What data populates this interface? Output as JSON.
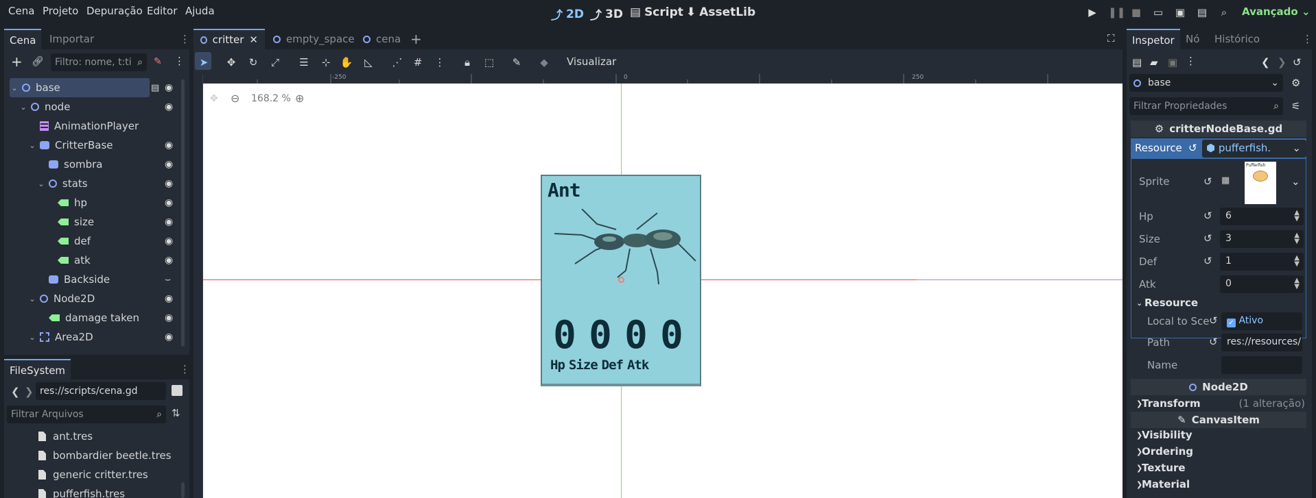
{
  "menu": [
    "Cena",
    "Projeto",
    "Depuração",
    "Editor",
    "Ajuda"
  ],
  "workspaces": {
    "w2d": "2D",
    "w3d": "3D",
    "script": "Script",
    "assetlib": "AssetLib"
  },
  "renderer": "Avançado",
  "scene_dock": {
    "tabs": [
      "Cena",
      "Importar"
    ],
    "filter_placeholder": "Filtro: nome, t:ti",
    "nodes": [
      {
        "label": "base",
        "icon": "node-circle",
        "depth": 0,
        "arrow": "expanded",
        "eye": true,
        "script": true,
        "selected": true
      },
      {
        "label": "node",
        "icon": "node-circle",
        "depth": 1,
        "arrow": "expanded",
        "eye": true
      },
      {
        "label": "AnimationPlayer",
        "icon": "animation-player",
        "depth": 2,
        "arrow": "",
        "eye": false
      },
      {
        "label": "CritterBase",
        "icon": "node-rect",
        "depth": 2,
        "arrow": "expanded",
        "eye": true
      },
      {
        "label": "sombra",
        "icon": "node-rect",
        "depth": 3,
        "arrow": "",
        "eye": true
      },
      {
        "label": "stats",
        "icon": "node-circle",
        "depth": 3,
        "arrow": "expanded",
        "eye": true
      },
      {
        "label": "hp",
        "icon": "node-tag",
        "depth": 4,
        "arrow": "",
        "eye": true
      },
      {
        "label": "size",
        "icon": "node-tag",
        "depth": 4,
        "arrow": "",
        "eye": true
      },
      {
        "label": "def",
        "icon": "node-tag",
        "depth": 4,
        "arrow": "",
        "eye": true
      },
      {
        "label": "atk",
        "icon": "node-tag",
        "depth": 4,
        "arrow": "",
        "eye": true
      },
      {
        "label": "Backside",
        "icon": "node-rect",
        "depth": 3,
        "arrow": "",
        "eye": false,
        "hidden": true
      },
      {
        "label": "Node2D",
        "icon": "node-circle",
        "depth": 2,
        "arrow": "expanded",
        "eye": true
      },
      {
        "label": "damage taken",
        "icon": "node-tag",
        "depth": 3,
        "arrow": "",
        "eye": true
      },
      {
        "label": "Area2D",
        "icon": "node-area",
        "depth": 2,
        "arrow": "expanded",
        "eye": true
      }
    ]
  },
  "filesystem": {
    "title": "FileSystem",
    "path": "res://scripts/cena.gd",
    "filter_placeholder": "Filtrar Arquivos",
    "files": [
      "ant.tres",
      "bombardier beetle.tres",
      "generic critter.tres",
      "pufferfish.tres"
    ]
  },
  "editor_tabs": [
    {
      "label": "critter",
      "active": true
    },
    {
      "label": "empty_space",
      "active": false
    },
    {
      "label": "cena",
      "active": false
    }
  ],
  "viewport": {
    "view_label": "Visualizar",
    "zoom": "168.2 %",
    "ruler": [
      "-250",
      "0",
      "250"
    ],
    "card": {
      "name": "Ant",
      "digits": [
        "0",
        "0",
        "0",
        "0"
      ],
      "stat_labels": [
        "Hp",
        "Size",
        "Def",
        "Atk"
      ]
    },
    "colors": {
      "card_bg": "#91d1dc",
      "card_border": "#5a7d86",
      "ink": "#0e2d39"
    }
  },
  "inspector": {
    "tabs": [
      "Inspetor",
      "Nó",
      "Histórico"
    ],
    "object": "base",
    "filter_placeholder": "Filtrar Propriedades",
    "script_name": "critterNodeBase.gd",
    "resource_label": "Resource",
    "resource_value": "pufferfish.",
    "sprite_label": "Sprite",
    "sprite_thumb_text": "Pufferfish",
    "props": [
      {
        "label": "Hp",
        "value": "6"
      },
      {
        "label": "Size",
        "value": "3"
      },
      {
        "label": "Def",
        "value": "1"
      },
      {
        "label": "Atk",
        "value": "0"
      }
    ],
    "resource_section": "Resource",
    "local_to_scene_label": "Local to Sce",
    "local_to_scene_value": "Ativo",
    "path_label": "Path",
    "path_value": "res://resources/",
    "name_label": "Name",
    "node2d_header": "Node2D",
    "transform_label": "Transform",
    "transform_note": "(1 alteração)",
    "canvasitem_header": "CanvasItem",
    "sections": [
      "Visibility",
      "Ordering",
      "Texture",
      "Material"
    ]
  }
}
